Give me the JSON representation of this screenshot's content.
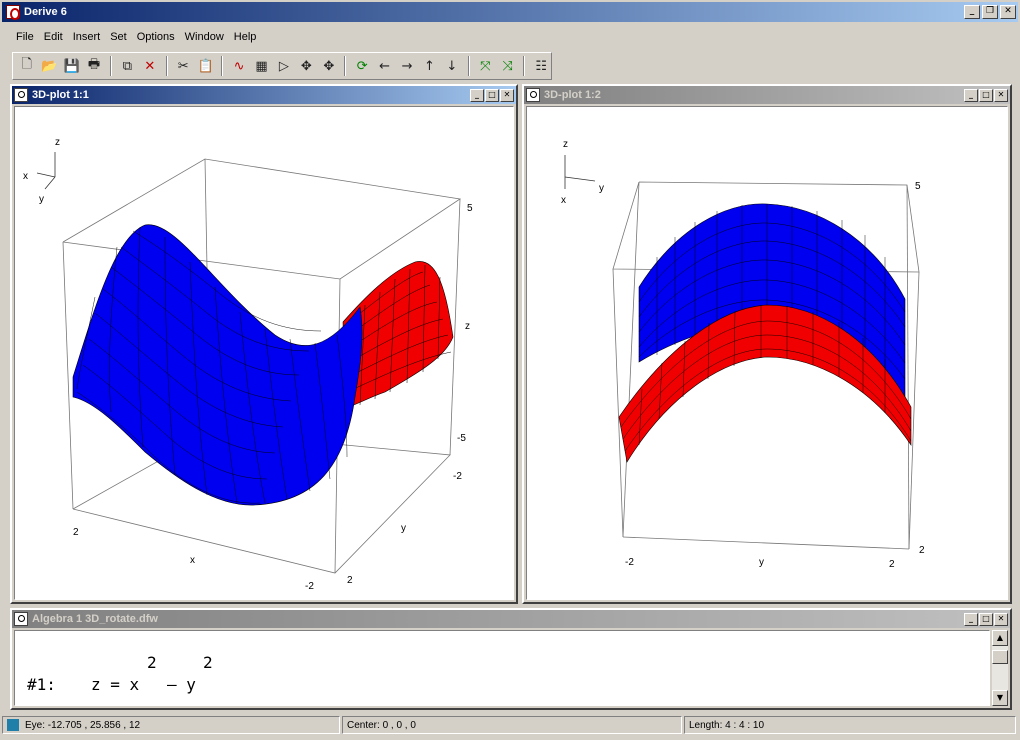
{
  "app": {
    "title": "Derive 6"
  },
  "menu": [
    "File",
    "Edit",
    "Insert",
    "Set",
    "Options",
    "Window",
    "Help"
  ],
  "plot1": {
    "title": "3D-plot 1:1",
    "labels": {
      "orient_z": "z",
      "orient_x": "x",
      "orient_y": "y",
      "z_top": "5",
      "z_mid": "z",
      "z_bottom": "-5",
      "y_neg": "-2",
      "y_label": "y",
      "y_pos": "2",
      "x_pos": "2",
      "x_label": "x",
      "x_neg": "-2"
    }
  },
  "plot2": {
    "title": "3D-plot 1:2",
    "labels": {
      "orient_z": "z",
      "orient_x": "x",
      "orient_y": "y",
      "z_top": "5",
      "y_neg": "-2",
      "y_label": "y",
      "y_pos": "2",
      "x_pos": "2"
    }
  },
  "algebra": {
    "title": "Algebra 1   3D_rotate.dfw",
    "expr_label": "#1:",
    "expr_lhs": "z  =  x",
    "expr_minus": "–  y",
    "exp1": "2",
    "exp2": "2"
  },
  "status": {
    "eye": "Eye: -12.705 , 25.856 , 12",
    "center": "Center: 0 , 0 , 0",
    "length": "Length: 4 : 4 : 10"
  },
  "colors": {
    "surface_blue": "#0000f0",
    "surface_red": "#f00000",
    "title_active": "#0a246a"
  }
}
